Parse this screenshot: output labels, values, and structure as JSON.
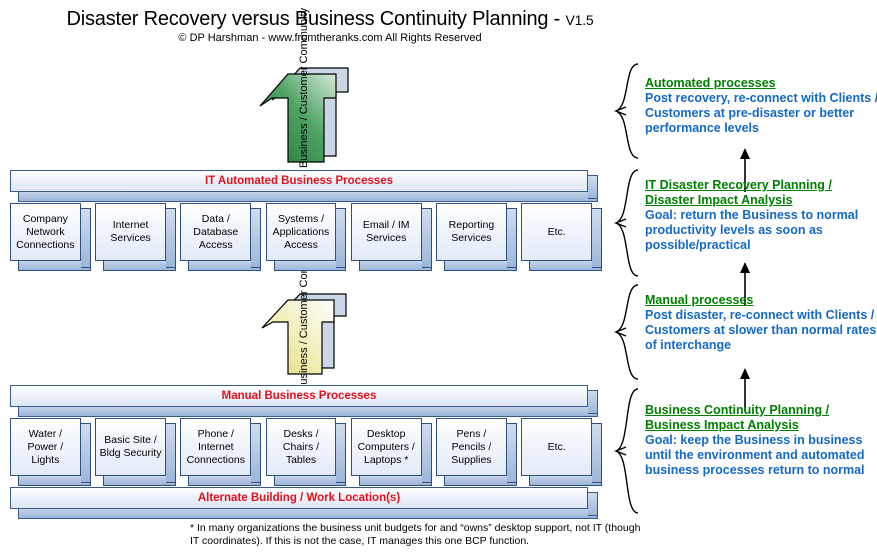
{
  "title": {
    "main": "Disaster Recovery versus Business Continuity Planning - ",
    "version": "V1.5",
    "subtitle": "© DP Harshman - www.fromtheranks.com  All Rights Reserved"
  },
  "arrows": {
    "top": {
      "label": "Business / Customer Community",
      "fill_start": "#2e8b45",
      "fill_end": "#cfe6d5"
    },
    "middle": {
      "label": "Business / Customer Community",
      "fill_start": "#e8e48a",
      "fill_end": "#ffffff"
    }
  },
  "bars": {
    "it_automated": "IT Automated Business Processes",
    "manual": "Manual Business Processes",
    "alternate": "Alternate Building / Work Location(s)",
    "color": "#e8101a"
  },
  "it_boxes": [
    "Company Network Connections",
    "Internet Services",
    "Data / Database Access",
    "Systems / Applications Access",
    "Email / IM Services",
    "Reporting Services",
    "Etc."
  ],
  "manual_boxes": [
    "Water / Power / Lights",
    "Basic Site / Bldg Security",
    "Phone / Internet Connections",
    "Desks / Chairs / Tables",
    "Desktop Computers / Laptops *",
    "Pens / Pencils / Supplies",
    "Etc."
  ],
  "notes": [
    {
      "heading": "Automated processes",
      "body": "Post recovery, re-connect with Clients / Customers at pre-disaster or better performance levels"
    },
    {
      "heading": "IT Disaster Recovery Planning / Disaster Impact Analysis",
      "body": "Goal:  return the Business to normal productivity levels as soon as possible/practical"
    },
    {
      "heading": "Manual processes",
      "body": "Post disaster, re-connect with Clients / Customers at slower than normal rates of interchange"
    },
    {
      "heading": "Business Continuity Planning / Business Impact Analysis",
      "body": "Goal:  keep the Business in business until the environment and automated business processes return to normal"
    }
  ],
  "note_colors": {
    "heading": "#008000",
    "body": "#1569c7"
  },
  "footnote": "* In many organizations the business unit budgets for and “owns” desktop support, not IT (though IT coordinates).  If this is not the case, IT manages this one BCP function."
}
